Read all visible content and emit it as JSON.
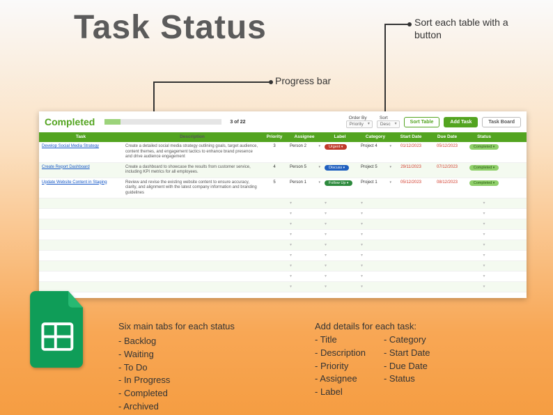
{
  "page": {
    "title": "Task Status"
  },
  "callouts": {
    "sort": "Sort each table with a button",
    "progress": "Progress bar"
  },
  "sheet": {
    "title": "Completed",
    "progress": {
      "label": "3 of 22",
      "percent": 13.6
    },
    "controls": {
      "order_by_label": "Order By",
      "order_by_value": "Priority",
      "sort_label": "Sort",
      "sort_value": "Desc",
      "sort_table_btn": "Sort Table",
      "add_task_btn": "Add Task",
      "task_board_btn": "Task Board"
    },
    "columns": [
      "Task",
      "Description",
      "Priority",
      "Assignee",
      "Label",
      "Category",
      "Start Date",
      "Due Date",
      "Status"
    ],
    "rows": [
      {
        "task": "Develop Social Media Strategy",
        "description": "Create a detailed social media strategy outlining goals, target audience, content themes, and engagement tactics to enhance brand presence and drive audience engagement",
        "priority": "3",
        "assignee": "Person 2",
        "label": "Urgent",
        "label_class": "urgent",
        "category": "Project 4",
        "start_date": "01/12/2023",
        "due_date": "05/12/2023",
        "status": "Completed"
      },
      {
        "task": "Create Report Dashboard",
        "description": "Create a dashboard to showcase the results from customer service, including KPI metrics for all employees.",
        "priority": "4",
        "assignee": "Person 5",
        "label": "Discuss",
        "label_class": "discuss",
        "category": "Project 5",
        "start_date": "29/11/2023",
        "due_date": "07/12/2023",
        "status": "Completed"
      },
      {
        "task": "Update Website Content in Staging",
        "description": "Review and revise the existing website content to ensure accuracy, clarity, and alignment with the latest company information and branding guidelines",
        "priority": "5",
        "assignee": "Person 1",
        "label": "Follow Up",
        "label_class": "followup",
        "category": "Project 1",
        "start_date": "05/12/2023",
        "due_date": "08/12/2023",
        "status": "Completed"
      }
    ],
    "empty_rows": 9
  },
  "bottom": {
    "tabs_header": "Six main tabs for each status",
    "tabs": [
      "Backlog",
      "Waiting",
      "To Do",
      "In Progress",
      "Completed",
      "Archived"
    ],
    "details_header": "Add details for each task:",
    "details_col1": [
      "Title",
      "Description",
      "Priority",
      "Assignee",
      "Label"
    ],
    "details_col2": [
      "Category",
      "Start Date",
      "Due Date",
      "Status"
    ]
  }
}
